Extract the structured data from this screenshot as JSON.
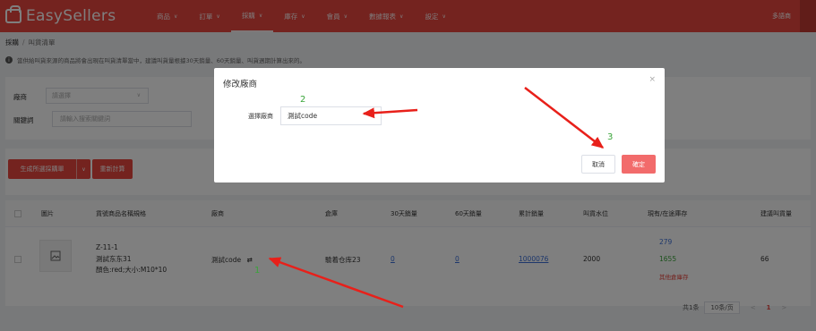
{
  "app": {
    "name": "EasySellers",
    "user": "多語商"
  },
  "nav": [
    {
      "label": "商品",
      "active": false
    },
    {
      "label": "訂單",
      "active": false
    },
    {
      "label": "採購",
      "active": true
    },
    {
      "label": "庫存",
      "active": false
    },
    {
      "label": "會員",
      "active": false
    },
    {
      "label": "數據報表",
      "active": false
    },
    {
      "label": "設定",
      "active": false
    }
  ],
  "breadcrumb": {
    "parent": "採購",
    "current": "叫貨清單"
  },
  "notice": "當供給叫貨來源的商品將會出現在叫貨清單當中，建議叫貨量根據30天銷量、60天銷量、叫貨週期計算出來的。",
  "filters": {
    "vendor_label": "廠商",
    "vendor_placeholder": "請選擇",
    "keyword_label": "關鍵詞",
    "keyword_placeholder": "請輸入搜索關鍵詞"
  },
  "actions": {
    "create_order": "生成所選採購單",
    "recalculate": "重新計算"
  },
  "table": {
    "headers": [
      "圖片",
      "貨號商品名稱規格",
      "廠商",
      "倉庫",
      "30天銷量",
      "60天銷量",
      "累計銷量",
      "叫貨水位",
      "現有/在途庫存",
      "建議叫貨量"
    ],
    "row": {
      "sku": "Z-11-1",
      "name": "測試东东31",
      "spec": "顏色:red;大小:M10*10",
      "vendor": "測試code",
      "warehouse": "驗着仓库23",
      "sales_30": "0",
      "sales_60": "0",
      "sales_total": "1000076",
      "level": "2000",
      "stock_current": "279",
      "stock_transit": "1655",
      "stock_note": "其他倉庫存",
      "suggest": "66"
    }
  },
  "pager": {
    "total": "共1条",
    "size": "10条/页",
    "prev": "<",
    "page": "1",
    "next": ">"
  },
  "modal": {
    "title": "修改廠商",
    "close": "×",
    "field_label": "選擇廠商",
    "field_value": "測試code",
    "cancel": "取消",
    "ok": "確定"
  },
  "annotations": [
    "1",
    "2",
    "3"
  ],
  "colors": {
    "brand": "#e9463f",
    "link": "#3b6fd8",
    "annotation": "#3aa53a",
    "arrow": "#e8201a"
  }
}
